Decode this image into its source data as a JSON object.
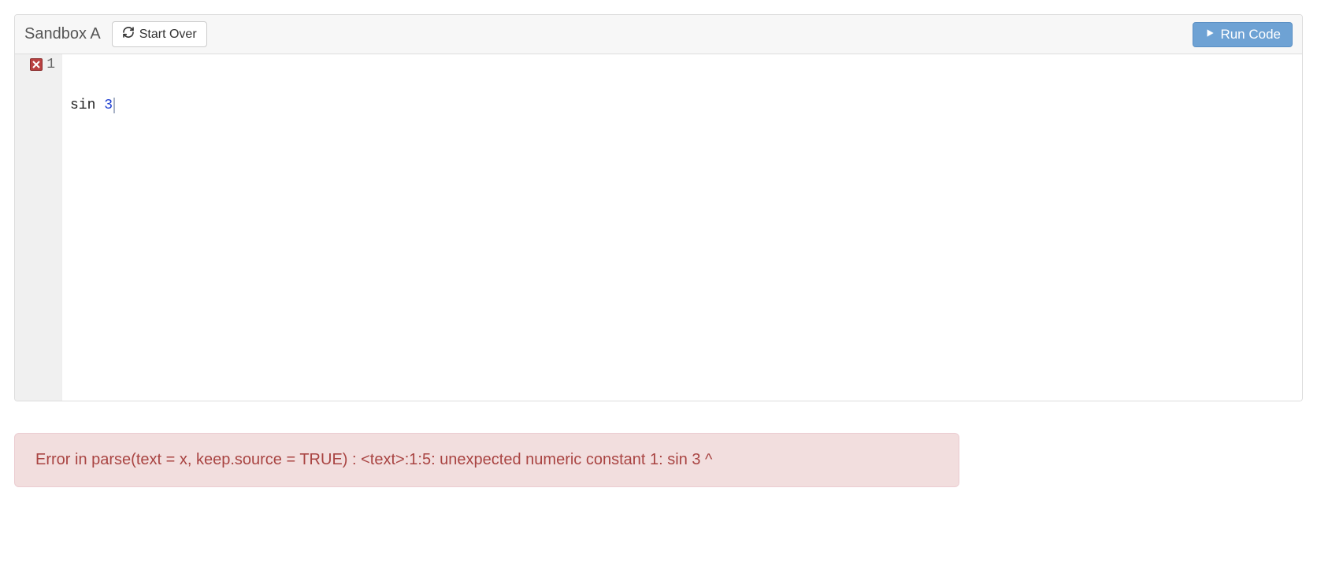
{
  "toolbar": {
    "title": "Sandbox A",
    "start_over_label": "Start Over",
    "run_label": "Run Code"
  },
  "editor": {
    "line_number": "1",
    "line_has_error": true,
    "code_tokens": {
      "t1": "sin",
      "sp": " ",
      "t2": "3"
    }
  },
  "error": {
    "message": "Error in parse(text = x, keep.source = TRUE) : <text>:1:5: unexpected numeric constant 1: sin 3 ^"
  }
}
